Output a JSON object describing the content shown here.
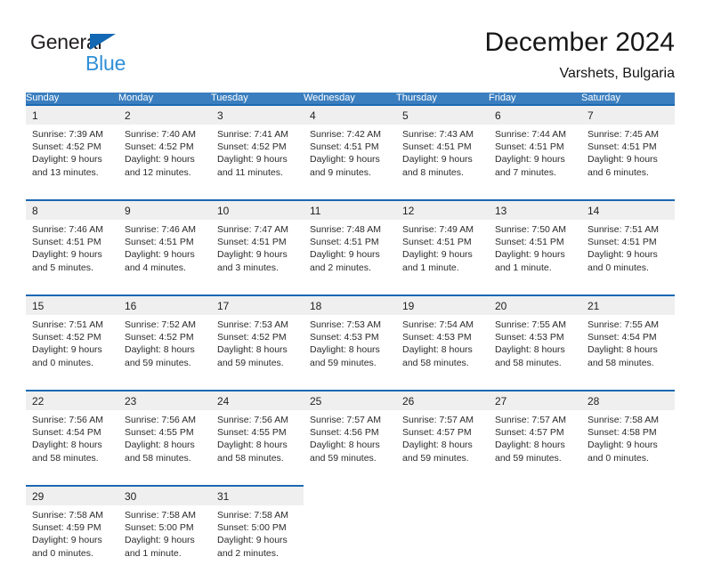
{
  "brand": {
    "name_dark": "General",
    "name_blue": "Blue",
    "accent_blue": "#2f8fd6",
    "triangle_blue": "#1268b3"
  },
  "header": {
    "title": "December 2024",
    "subtitle": "Varshets, Bulgaria"
  },
  "theme": {
    "header_row_bg": "#3a7ebf",
    "week_border": "#1b69b3",
    "daynum_bg": "#efefef"
  },
  "calendar": {
    "day_headers": [
      "Sunday",
      "Monday",
      "Tuesday",
      "Wednesday",
      "Thursday",
      "Friday",
      "Saturday"
    ],
    "weeks": [
      [
        {
          "day": "1",
          "sunrise": "Sunrise: 7:39 AM",
          "sunset": "Sunset: 4:52 PM",
          "daylight_1": "Daylight: 9 hours",
          "daylight_2": "and 13 minutes."
        },
        {
          "day": "2",
          "sunrise": "Sunrise: 7:40 AM",
          "sunset": "Sunset: 4:52 PM",
          "daylight_1": "Daylight: 9 hours",
          "daylight_2": "and 12 minutes."
        },
        {
          "day": "3",
          "sunrise": "Sunrise: 7:41 AM",
          "sunset": "Sunset: 4:52 PM",
          "daylight_1": "Daylight: 9 hours",
          "daylight_2": "and 11 minutes."
        },
        {
          "day": "4",
          "sunrise": "Sunrise: 7:42 AM",
          "sunset": "Sunset: 4:51 PM",
          "daylight_1": "Daylight: 9 hours",
          "daylight_2": "and 9 minutes."
        },
        {
          "day": "5",
          "sunrise": "Sunrise: 7:43 AM",
          "sunset": "Sunset: 4:51 PM",
          "daylight_1": "Daylight: 9 hours",
          "daylight_2": "and 8 minutes."
        },
        {
          "day": "6",
          "sunrise": "Sunrise: 7:44 AM",
          "sunset": "Sunset: 4:51 PM",
          "daylight_1": "Daylight: 9 hours",
          "daylight_2": "and 7 minutes."
        },
        {
          "day": "7",
          "sunrise": "Sunrise: 7:45 AM",
          "sunset": "Sunset: 4:51 PM",
          "daylight_1": "Daylight: 9 hours",
          "daylight_2": "and 6 minutes."
        }
      ],
      [
        {
          "day": "8",
          "sunrise": "Sunrise: 7:46 AM",
          "sunset": "Sunset: 4:51 PM",
          "daylight_1": "Daylight: 9 hours",
          "daylight_2": "and 5 minutes."
        },
        {
          "day": "9",
          "sunrise": "Sunrise: 7:46 AM",
          "sunset": "Sunset: 4:51 PM",
          "daylight_1": "Daylight: 9 hours",
          "daylight_2": "and 4 minutes."
        },
        {
          "day": "10",
          "sunrise": "Sunrise: 7:47 AM",
          "sunset": "Sunset: 4:51 PM",
          "daylight_1": "Daylight: 9 hours",
          "daylight_2": "and 3 minutes."
        },
        {
          "day": "11",
          "sunrise": "Sunrise: 7:48 AM",
          "sunset": "Sunset: 4:51 PM",
          "daylight_1": "Daylight: 9 hours",
          "daylight_2": "and 2 minutes."
        },
        {
          "day": "12",
          "sunrise": "Sunrise: 7:49 AM",
          "sunset": "Sunset: 4:51 PM",
          "daylight_1": "Daylight: 9 hours",
          "daylight_2": "and 1 minute."
        },
        {
          "day": "13",
          "sunrise": "Sunrise: 7:50 AM",
          "sunset": "Sunset: 4:51 PM",
          "daylight_1": "Daylight: 9 hours",
          "daylight_2": "and 1 minute."
        },
        {
          "day": "14",
          "sunrise": "Sunrise: 7:51 AM",
          "sunset": "Sunset: 4:51 PM",
          "daylight_1": "Daylight: 9 hours",
          "daylight_2": "and 0 minutes."
        }
      ],
      [
        {
          "day": "15",
          "sunrise": "Sunrise: 7:51 AM",
          "sunset": "Sunset: 4:52 PM",
          "daylight_1": "Daylight: 9 hours",
          "daylight_2": "and 0 minutes."
        },
        {
          "day": "16",
          "sunrise": "Sunrise: 7:52 AM",
          "sunset": "Sunset: 4:52 PM",
          "daylight_1": "Daylight: 8 hours",
          "daylight_2": "and 59 minutes."
        },
        {
          "day": "17",
          "sunrise": "Sunrise: 7:53 AM",
          "sunset": "Sunset: 4:52 PM",
          "daylight_1": "Daylight: 8 hours",
          "daylight_2": "and 59 minutes."
        },
        {
          "day": "18",
          "sunrise": "Sunrise: 7:53 AM",
          "sunset": "Sunset: 4:53 PM",
          "daylight_1": "Daylight: 8 hours",
          "daylight_2": "and 59 minutes."
        },
        {
          "day": "19",
          "sunrise": "Sunrise: 7:54 AM",
          "sunset": "Sunset: 4:53 PM",
          "daylight_1": "Daylight: 8 hours",
          "daylight_2": "and 58 minutes."
        },
        {
          "day": "20",
          "sunrise": "Sunrise: 7:55 AM",
          "sunset": "Sunset: 4:53 PM",
          "daylight_1": "Daylight: 8 hours",
          "daylight_2": "and 58 minutes."
        },
        {
          "day": "21",
          "sunrise": "Sunrise: 7:55 AM",
          "sunset": "Sunset: 4:54 PM",
          "daylight_1": "Daylight: 8 hours",
          "daylight_2": "and 58 minutes."
        }
      ],
      [
        {
          "day": "22",
          "sunrise": "Sunrise: 7:56 AM",
          "sunset": "Sunset: 4:54 PM",
          "daylight_1": "Daylight: 8 hours",
          "daylight_2": "and 58 minutes."
        },
        {
          "day": "23",
          "sunrise": "Sunrise: 7:56 AM",
          "sunset": "Sunset: 4:55 PM",
          "daylight_1": "Daylight: 8 hours",
          "daylight_2": "and 58 minutes."
        },
        {
          "day": "24",
          "sunrise": "Sunrise: 7:56 AM",
          "sunset": "Sunset: 4:55 PM",
          "daylight_1": "Daylight: 8 hours",
          "daylight_2": "and 58 minutes."
        },
        {
          "day": "25",
          "sunrise": "Sunrise: 7:57 AM",
          "sunset": "Sunset: 4:56 PM",
          "daylight_1": "Daylight: 8 hours",
          "daylight_2": "and 59 minutes."
        },
        {
          "day": "26",
          "sunrise": "Sunrise: 7:57 AM",
          "sunset": "Sunset: 4:57 PM",
          "daylight_1": "Daylight: 8 hours",
          "daylight_2": "and 59 minutes."
        },
        {
          "day": "27",
          "sunrise": "Sunrise: 7:57 AM",
          "sunset": "Sunset: 4:57 PM",
          "daylight_1": "Daylight: 8 hours",
          "daylight_2": "and 59 minutes."
        },
        {
          "day": "28",
          "sunrise": "Sunrise: 7:58 AM",
          "sunset": "Sunset: 4:58 PM",
          "daylight_1": "Daylight: 9 hours",
          "daylight_2": "and 0 minutes."
        }
      ],
      [
        {
          "day": "29",
          "sunrise": "Sunrise: 7:58 AM",
          "sunset": "Sunset: 4:59 PM",
          "daylight_1": "Daylight: 9 hours",
          "daylight_2": "and 0 minutes."
        },
        {
          "day": "30",
          "sunrise": "Sunrise: 7:58 AM",
          "sunset": "Sunset: 5:00 PM",
          "daylight_1": "Daylight: 9 hours",
          "daylight_2": "and 1 minute."
        },
        {
          "day": "31",
          "sunrise": "Sunrise: 7:58 AM",
          "sunset": "Sunset: 5:00 PM",
          "daylight_1": "Daylight: 9 hours",
          "daylight_2": "and 2 minutes."
        },
        {
          "day": "",
          "sunrise": "",
          "sunset": "",
          "daylight_1": "",
          "daylight_2": ""
        },
        {
          "day": "",
          "sunrise": "",
          "sunset": "",
          "daylight_1": "",
          "daylight_2": ""
        },
        {
          "day": "",
          "sunrise": "",
          "sunset": "",
          "daylight_1": "",
          "daylight_2": ""
        },
        {
          "day": "",
          "sunrise": "",
          "sunset": "",
          "daylight_1": "",
          "daylight_2": ""
        }
      ]
    ]
  }
}
